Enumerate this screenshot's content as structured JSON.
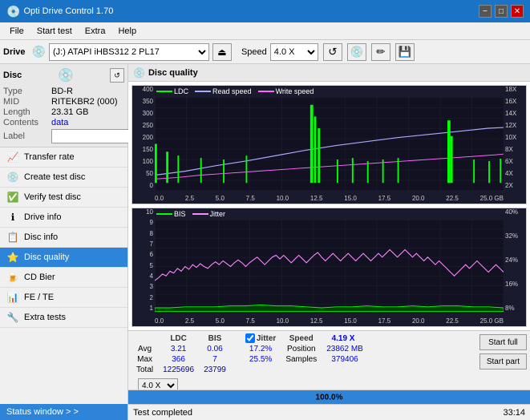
{
  "titlebar": {
    "title": "Opti Drive Control 1.70",
    "minimize": "−",
    "maximize": "□",
    "close": "✕"
  },
  "menubar": {
    "items": [
      "File",
      "Start test",
      "Extra",
      "Help"
    ]
  },
  "drivebar": {
    "drive_label": "Drive",
    "drive_value": "(J:)  ATAPI iHBS312  2 PL17",
    "speed_label": "Speed",
    "speed_value": "4.0 X"
  },
  "disc": {
    "type_label": "Type",
    "type_value": "BD-R",
    "mid_label": "MID",
    "mid_value": "RITEKBR2 (000)",
    "length_label": "Length",
    "length_value": "23.31 GB",
    "contents_label": "Contents",
    "contents_value": "data",
    "label_label": "Label",
    "label_value": ""
  },
  "nav": {
    "items": [
      {
        "id": "transfer-rate",
        "label": "Transfer rate",
        "icon": "📈"
      },
      {
        "id": "create-test-disc",
        "label": "Create test disc",
        "icon": "💿"
      },
      {
        "id": "verify-test-disc",
        "label": "Verify test disc",
        "icon": "✅"
      },
      {
        "id": "drive-info",
        "label": "Drive info",
        "icon": "ℹ"
      },
      {
        "id": "disc-info",
        "label": "Disc info",
        "icon": "📋"
      },
      {
        "id": "disc-quality",
        "label": "Disc quality",
        "icon": "⭐",
        "active": true
      },
      {
        "id": "cd-bier",
        "label": "CD Bier",
        "icon": "🍺"
      },
      {
        "id": "fe-te",
        "label": "FE / TE",
        "icon": "📊"
      },
      {
        "id": "extra-tests",
        "label": "Extra tests",
        "icon": "🔧"
      }
    ]
  },
  "status_window": "Status window > >",
  "chart_title": "Disc quality",
  "chart1": {
    "legend": [
      {
        "label": "LDC",
        "color": "#00ff00"
      },
      {
        "label": "Read speed",
        "color": "#aaaaff"
      },
      {
        "label": "Write speed",
        "color": "#ff66ff"
      }
    ],
    "y_axis_left": [
      "400",
      "350",
      "300",
      "250",
      "200",
      "150",
      "100",
      "50",
      "0"
    ],
    "y_axis_right": [
      "18X",
      "16X",
      "14X",
      "12X",
      "10X",
      "8X",
      "6X",
      "4X",
      "2X"
    ],
    "x_axis": [
      "0.0",
      "2.5",
      "5.0",
      "7.5",
      "10.0",
      "12.5",
      "15.0",
      "17.5",
      "20.0",
      "22.5",
      "25.0 GB"
    ]
  },
  "chart2": {
    "legend": [
      {
        "label": "BIS",
        "color": "#00ff00"
      },
      {
        "label": "Jitter",
        "color": "#ff88ff"
      }
    ],
    "y_axis_left": [
      "10",
      "9",
      "8",
      "7",
      "6",
      "5",
      "4",
      "3",
      "2",
      "1"
    ],
    "y_axis_right": [
      "40%",
      "32%",
      "24%",
      "16%",
      "8%"
    ],
    "x_axis": [
      "0.0",
      "2.5",
      "5.0",
      "7.5",
      "10.0",
      "12.5",
      "15.0",
      "17.5",
      "20.0",
      "22.5",
      "25.0 GB"
    ]
  },
  "stats": {
    "columns": [
      "",
      "LDC",
      "BIS",
      "",
      "Jitter",
      "Speed",
      ""
    ],
    "avg_label": "Avg",
    "avg_ldc": "3.21",
    "avg_bis": "0.06",
    "avg_jitter": "17.2%",
    "max_label": "Max",
    "max_ldc": "366",
    "max_bis": "7",
    "max_jitter": "25.5%",
    "total_label": "Total",
    "total_ldc": "1225696",
    "total_bis": "23799",
    "jitter_label": "Jitter",
    "speed_label": "Speed",
    "speed_value": "4.19 X",
    "speed_dropdown": "4.0 X",
    "position_label": "Position",
    "position_value": "23862 MB",
    "samples_label": "Samples",
    "samples_value": "379406"
  },
  "buttons": {
    "start_full": "Start full",
    "start_part": "Start part"
  },
  "progress": {
    "value": "100.0%"
  },
  "status_footer": {
    "message": "Test completed",
    "time": "33:14"
  }
}
